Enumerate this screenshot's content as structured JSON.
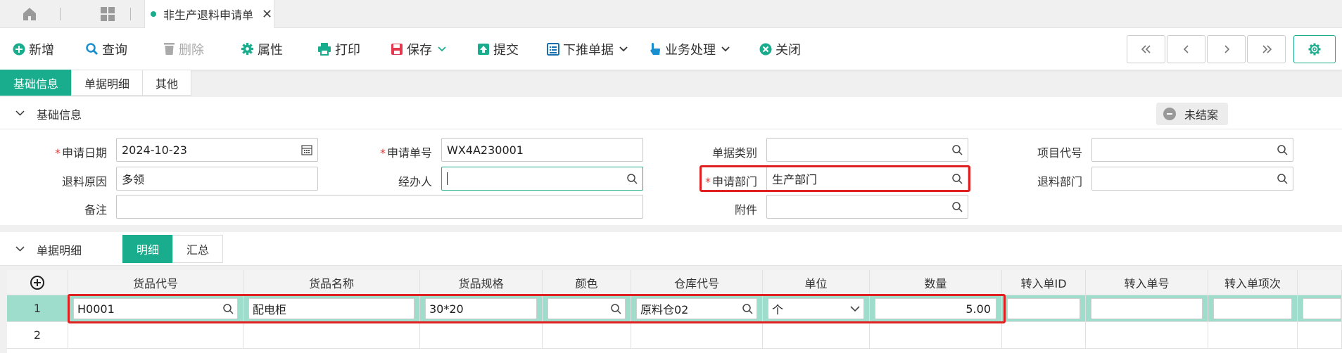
{
  "tabs": {
    "active_title": "非生产退料申请单"
  },
  "toolbar": {
    "new": "新增",
    "query": "查询",
    "delete": "删除",
    "props": "属性",
    "print": "打印",
    "save": "保存",
    "submit": "提交",
    "push_down": "下推单据",
    "business": "业务处理",
    "close": "关闭"
  },
  "section_tabs": [
    "基础信息",
    "单据明细",
    "其他"
  ],
  "basic_section": {
    "title": "基础信息",
    "status": "未结案"
  },
  "form": {
    "apply_date_label": "申请日期",
    "apply_date": "2024-10-23",
    "apply_no_label": "申请单号",
    "apply_no": "WX4A230001",
    "doc_type_label": "单据类别",
    "doc_type": "",
    "project_code_label": "项目代号",
    "project_code": "",
    "reason_label": "退料原因",
    "reason": "多领",
    "handler_label": "经办人",
    "handler": "",
    "dept_label": "申请部门",
    "dept": "生产部门",
    "return_dept_label": "退料部门",
    "return_dept": "",
    "remark_label": "备注",
    "remark": "",
    "attachment_label": "附件",
    "attachment": ""
  },
  "detail_section": {
    "title": "单据明细",
    "tabs": [
      "明细",
      "汇总"
    ]
  },
  "grid": {
    "headers": [
      "货品代号",
      "货品名称",
      "货品规格",
      "颜色",
      "仓库代号",
      "单位",
      "数量",
      "转入单ID",
      "转入单号",
      "转入单项次"
    ],
    "rows": [
      {
        "no": "1",
        "code": "H0001",
        "name": "配电柜",
        "spec": "30*20",
        "color": "",
        "warehouse": "原料仓02",
        "unit": "个",
        "qty": "5.00"
      },
      {
        "no": "2"
      }
    ]
  }
}
